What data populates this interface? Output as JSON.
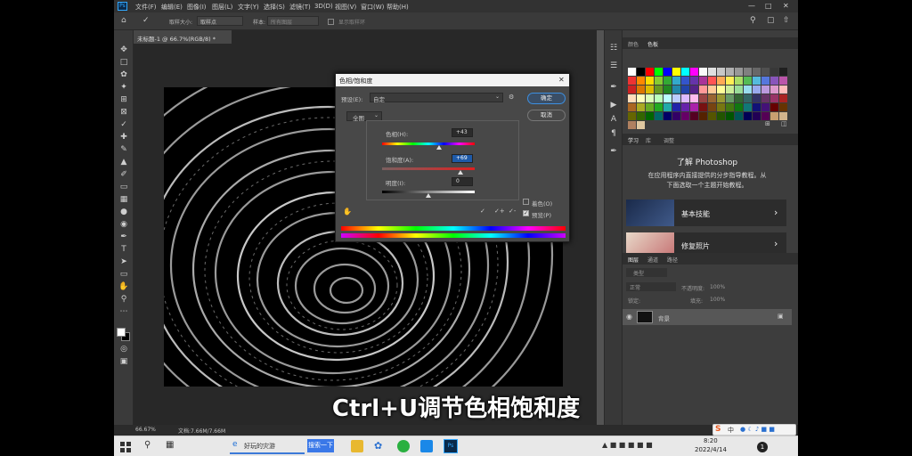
{
  "menu": {
    "ps_logo": "Ps",
    "items": [
      "文件(F)",
      "编辑(E)",
      "图像(I)",
      "图层(L)",
      "文字(Y)",
      "选择(S)",
      "滤镜(T)",
      "3D(D)",
      "视图(V)",
      "窗口(W)",
      "帮助(H)"
    ]
  },
  "options": {
    "sample_size_label": "取样大小:",
    "sample_size_value": "取样点",
    "sample_label": "样本:",
    "sample_value": "所有图层",
    "show_ring_label": "显示取样环"
  },
  "document": {
    "tab_title": "未标题-1 @ 66.7%(RGB/8) *",
    "zoom": "66.67%",
    "doc_info": "文档:7.66M/7.66M"
  },
  "dialog": {
    "title": "色相/饱和度",
    "preset_label": "预设(E):",
    "preset_value": "自定",
    "ok_label": "确定",
    "cancel_label": "取消",
    "channel_value": "全图",
    "hue_label": "色相(H):",
    "hue_value": "+43",
    "hue_level": 0.62,
    "saturation_label": "饱和度(A):",
    "saturation_value": "+69",
    "saturation_level": 0.85,
    "lightness_label": "明度(I):",
    "lightness_value": "0",
    "lightness_level": 0.5,
    "colorize_label": "着色(O)",
    "preview_label": "预览(P)"
  },
  "right_panel": {
    "tabs_top": [
      "颜色",
      "色板"
    ],
    "tabs_learn": [
      "学习",
      "库",
      "调整"
    ],
    "learn_title": "了解 Photoshop",
    "learn_desc_line1": "在应用程序内直接提供的分步指导教程。从",
    "learn_desc_line2": "下面选取一个主题开始教程。",
    "card1": "基本技能",
    "card2": "修复照片",
    "tabs_layers": [
      "图层",
      "通道",
      "路径"
    ],
    "layer_kind": "类型",
    "blend_mode": "正常",
    "opacity_label": "不透明度:",
    "opacity_value": "100%",
    "lock_label": "锁定:",
    "fill_label": "填充:",
    "fill_value": "100%",
    "layer_name": "背景"
  },
  "subtitle": "Ctrl+U调节色相饱和度",
  "taskbar": {
    "browser_label": "好玩的灾游",
    "search_button": "搜索一下",
    "time": "8:20",
    "date": "2022/4/14",
    "ime_label": "中",
    "notification_count": "1"
  },
  "swatch_colors": [
    "#ffffff",
    "#000000",
    "#ff0000",
    "#00ff00",
    "#0000ff",
    "#ffff00",
    "#00ffff",
    "#ff00ff",
    "#fafafa",
    "#e0e0e0",
    "#c8c8c8",
    "#b0b0b0",
    "#989898",
    "#808080",
    "#686868",
    "#505050",
    "#383838",
    "#202020",
    "#ee3333",
    "#ff8800",
    "#ffdd00",
    "#88cc33",
    "#33aa33",
    "#33aacc",
    "#3355cc",
    "#6633aa",
    "#aa3399",
    "#ff5555",
    "#ffaa55",
    "#ffee55",
    "#aadd66",
    "#55bb55",
    "#55bbdd",
    "#5577dd",
    "#8855bb",
    "#bb55aa",
    "#cc2222",
    "#dd7700",
    "#ddbb00",
    "#669922",
    "#228822",
    "#2288aa",
    "#2244aa",
    "#552288",
    "#ff9999",
    "#ffcc99",
    "#ffff99",
    "#ccee99",
    "#99dd99",
    "#99ddee",
    "#99aaee",
    "#bb99dd",
    "#dd99cc",
    "#ffbbbb",
    "#ffddbb",
    "#ffffbb",
    "#ddffbb",
    "#bbffbb",
    "#bbffff",
    "#bbccff",
    "#ddbbff",
    "#ffbbee",
    "#994444",
    "#996633",
    "#999933",
    "#669966",
    "#336633",
    "#336666",
    "#333366",
    "#663366",
    "#993366",
    "#aa2222",
    "#aa6622",
    "#aaaa22",
    "#66aa22",
    "#22aa22",
    "#22aaaa",
    "#2222aa",
    "#6622aa",
    "#aa22aa",
    "#771111",
    "#774411",
    "#777711",
    "#447711",
    "#117711",
    "#117777",
    "#111177",
    "#441177",
    "#660000",
    "#663300",
    "#666600",
    "#336600",
    "#006600",
    "#006666",
    "#000066",
    "#330066",
    "#660066",
    "#550022",
    "#552200",
    "#555500",
    "#225500",
    "#005500",
    "#005555",
    "#000055",
    "#220055",
    "#550055",
    "#c8a070",
    "#d2b48c",
    "#b08060",
    "#e0c8a0"
  ]
}
